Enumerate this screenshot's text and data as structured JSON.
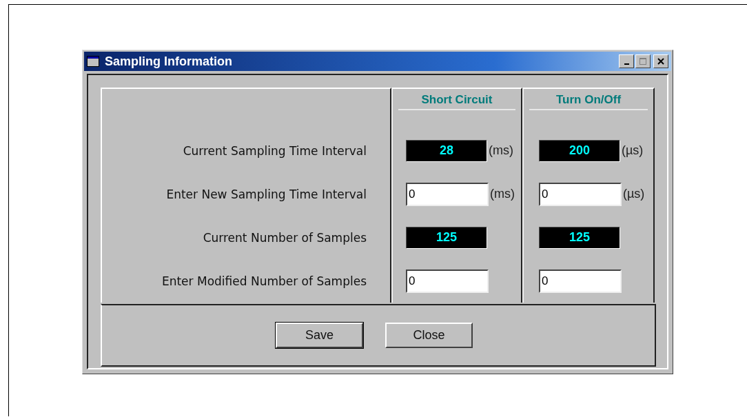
{
  "window": {
    "title": "Sampling Information"
  },
  "columns": [
    {
      "title": "Short Circuit"
    },
    {
      "title": "Turn On/Off"
    }
  ],
  "rows": [
    {
      "label": "Current Sampling Time Interval",
      "kind": "display",
      "cells": [
        {
          "value": "28",
          "unit": "(ms)"
        },
        {
          "value": "200",
          "unit": "(µs)"
        }
      ]
    },
    {
      "label": "Enter New Sampling Time Interval",
      "kind": "input",
      "cells": [
        {
          "value": "0",
          "unit": "(ms)"
        },
        {
          "value": "0",
          "unit": "(µs)"
        }
      ]
    },
    {
      "label": "Current Number of Samples",
      "kind": "display",
      "cells": [
        {
          "value": "125"
        },
        {
          "value": "125"
        }
      ]
    },
    {
      "label": "Enter Modified Number of Samples",
      "kind": "input",
      "cells": [
        {
          "value": "0"
        },
        {
          "value": "0"
        }
      ]
    }
  ],
  "buttons": [
    {
      "label": "Save",
      "default": true
    },
    {
      "label": "Close",
      "default": false
    }
  ]
}
